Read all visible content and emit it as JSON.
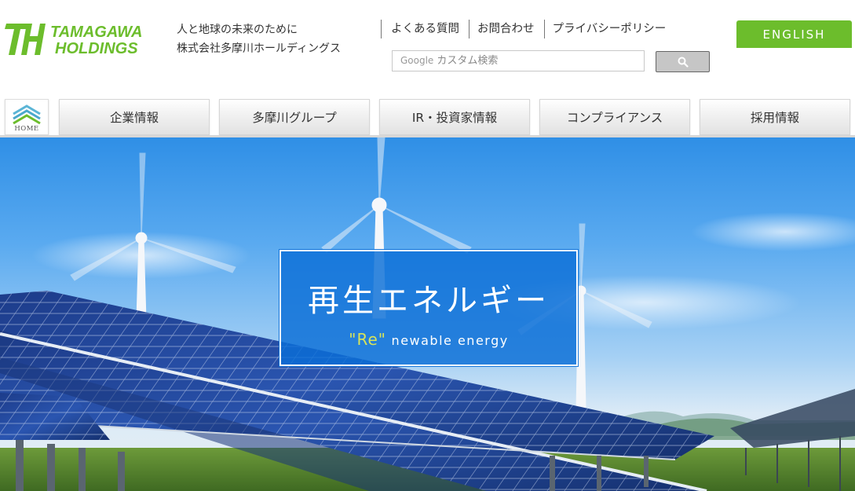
{
  "logo": {
    "line1": "TAMAGAWA",
    "line2": "HOLDINGS",
    "mark": "TH",
    "color": "#6cbd2c"
  },
  "tagline": {
    "line1": "人と地球の未来のために",
    "line2": "株式会社多摩川ホールディングス"
  },
  "util_nav": [
    {
      "label": "よくある質問"
    },
    {
      "label": "お問合わせ"
    },
    {
      "label": "プライバシーポリシー"
    }
  ],
  "english": {
    "label": "ENGLISH"
  },
  "search": {
    "brand": "Google",
    "placeholder": "カスタム検索",
    "button_icon": "search-icon"
  },
  "gnav": {
    "home": "HOME",
    "items": [
      {
        "label": "企業情報"
      },
      {
        "label": "多摩川グループ"
      },
      {
        "label": "IR・投資家情報"
      },
      {
        "label": "コンプライアンス"
      },
      {
        "label": "採用情報"
      }
    ]
  },
  "hero": {
    "title": "再生エネルギー",
    "re": "\"Re\"",
    "rest": " newable energy",
    "box_color": "#0a6ed7"
  }
}
